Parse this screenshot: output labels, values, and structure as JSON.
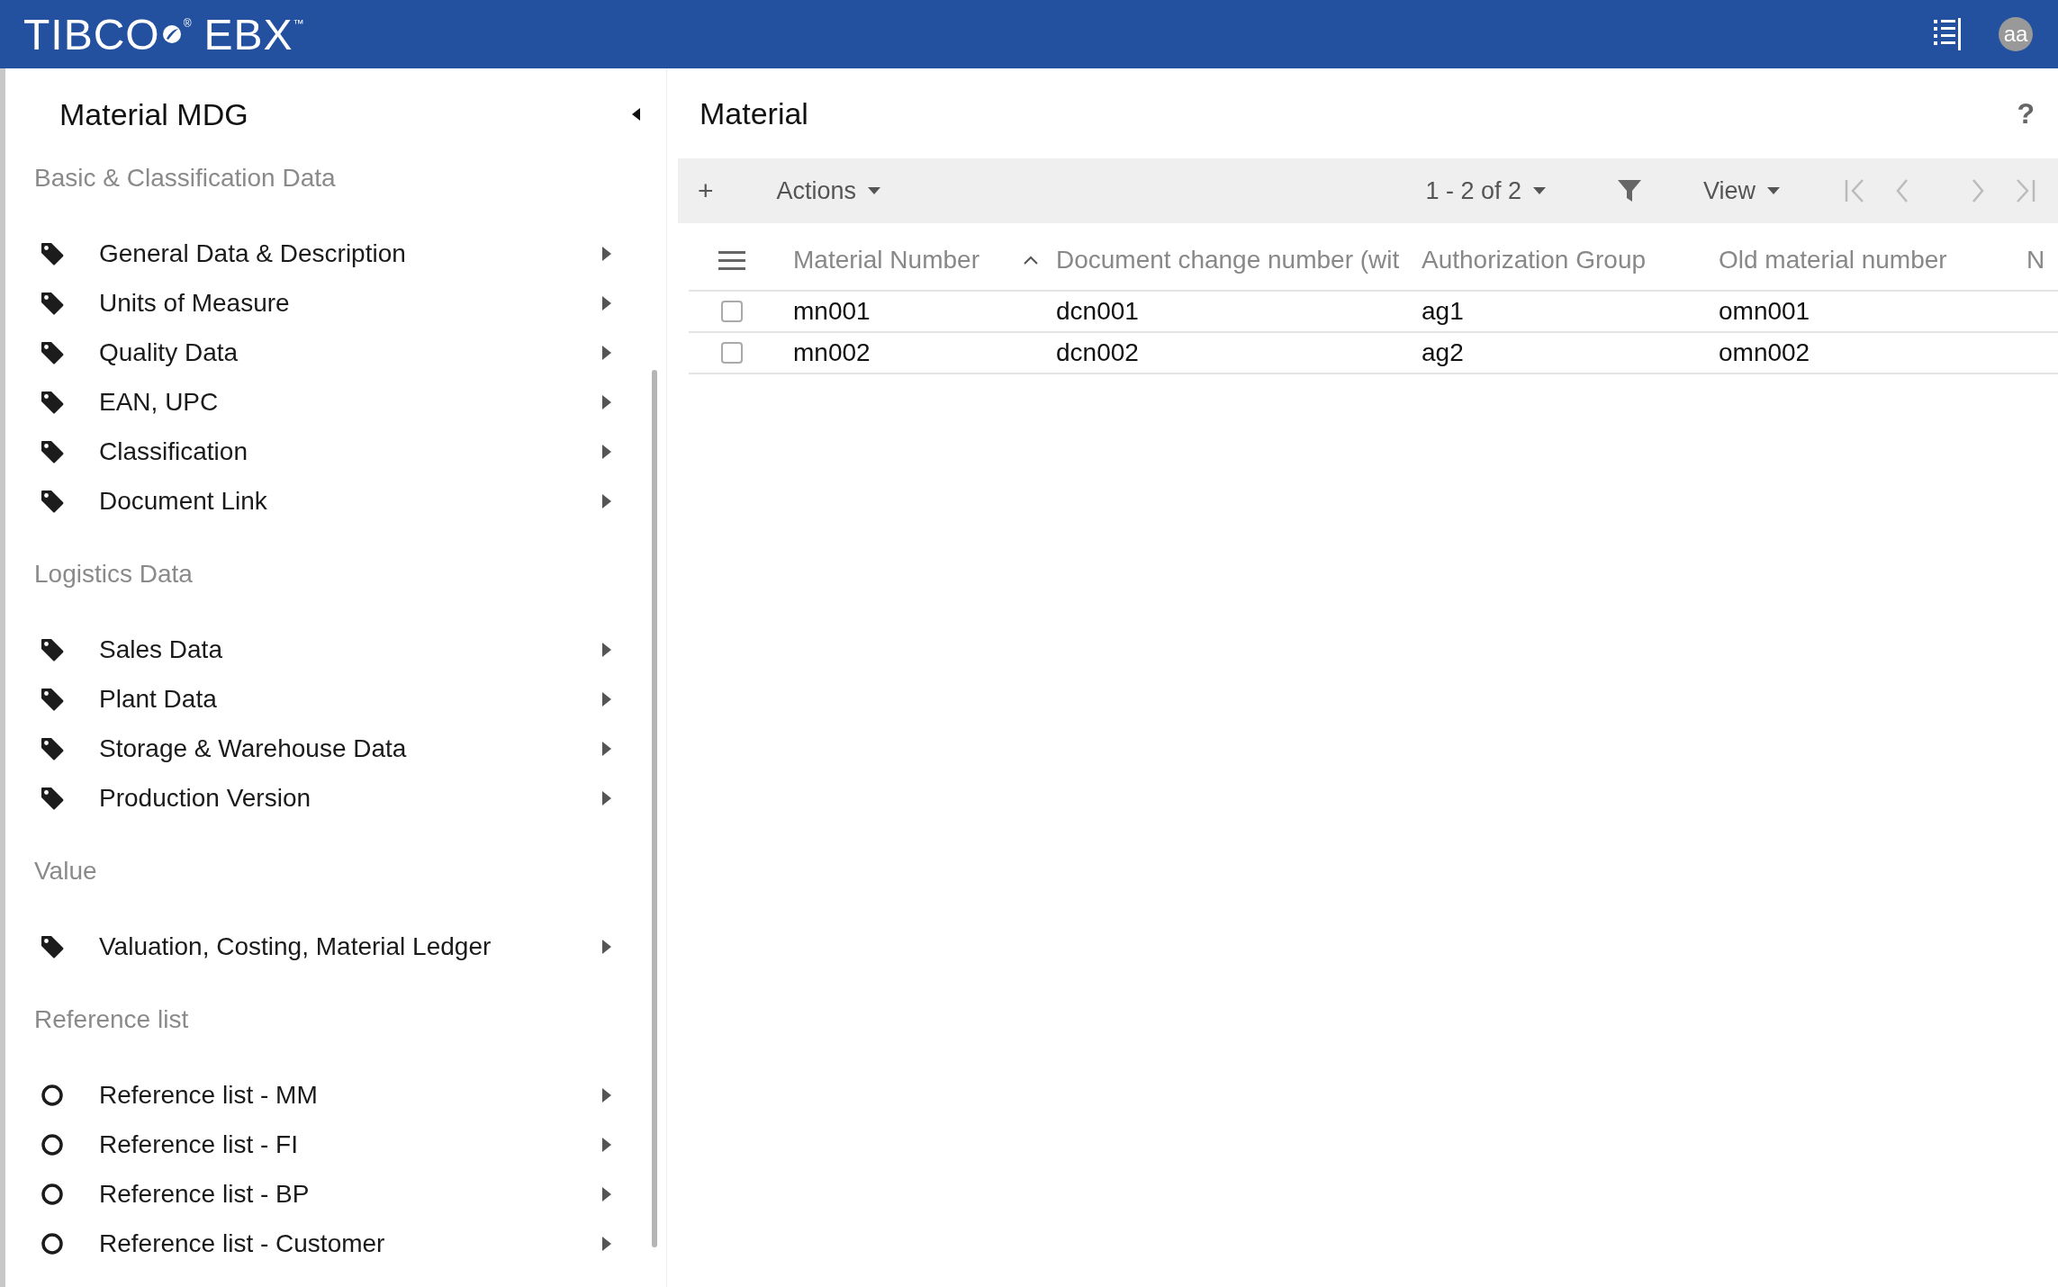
{
  "header": {
    "logo": "TIBCO",
    "logo_mark": "®",
    "logo_product": "EBX",
    "logo_tm": "™",
    "avatar": "aa"
  },
  "sidebar": {
    "title": "Material MDG",
    "sections": [
      {
        "title": "Basic & Classification Data",
        "items": [
          {
            "label": "General Data & Description",
            "kind": "tag"
          },
          {
            "label": "Units of Measure",
            "kind": "tag"
          },
          {
            "label": "Quality Data",
            "kind": "tag"
          },
          {
            "label": "EAN, UPC",
            "kind": "tag"
          },
          {
            "label": "Classification",
            "kind": "tag"
          },
          {
            "label": "Document Link",
            "kind": "tag"
          }
        ]
      },
      {
        "title": "Logistics Data",
        "items": [
          {
            "label": "Sales Data",
            "kind": "tag"
          },
          {
            "label": "Plant Data",
            "kind": "tag"
          },
          {
            "label": "Storage & Warehouse Data",
            "kind": "tag"
          },
          {
            "label": "Production Version",
            "kind": "tag"
          }
        ]
      },
      {
        "title": "Value",
        "items": [
          {
            "label": "Valuation, Costing, Material Ledger",
            "kind": "tag"
          }
        ]
      },
      {
        "title": "Reference list",
        "items": [
          {
            "label": "Reference list - MM",
            "kind": "list"
          },
          {
            "label": "Reference list - FI",
            "kind": "list"
          },
          {
            "label": "Reference list - BP",
            "kind": "list"
          },
          {
            "label": "Reference list - Customer",
            "kind": "list"
          }
        ]
      }
    ]
  },
  "main": {
    "title": "Material",
    "help": "?",
    "toolbar": {
      "add": "+",
      "actions": "Actions",
      "pagination": "1 - 2 of 2",
      "view": "View"
    },
    "table": {
      "columns": [
        {
          "label": "Material Number",
          "sorted": true
        },
        {
          "label": "Document change number (wit",
          "sorted": false
        },
        {
          "label": "Authorization Group",
          "sorted": false
        },
        {
          "label": "Old material number",
          "sorted": false
        },
        {
          "label": "N"
        }
      ],
      "rows": [
        {
          "checked": false,
          "cells": [
            "mn001",
            "dcn001",
            "ag1",
            "omn001"
          ]
        },
        {
          "checked": false,
          "cells": [
            "mn002",
            "dcn002",
            "ag2",
            "omn002"
          ]
        }
      ]
    }
  }
}
